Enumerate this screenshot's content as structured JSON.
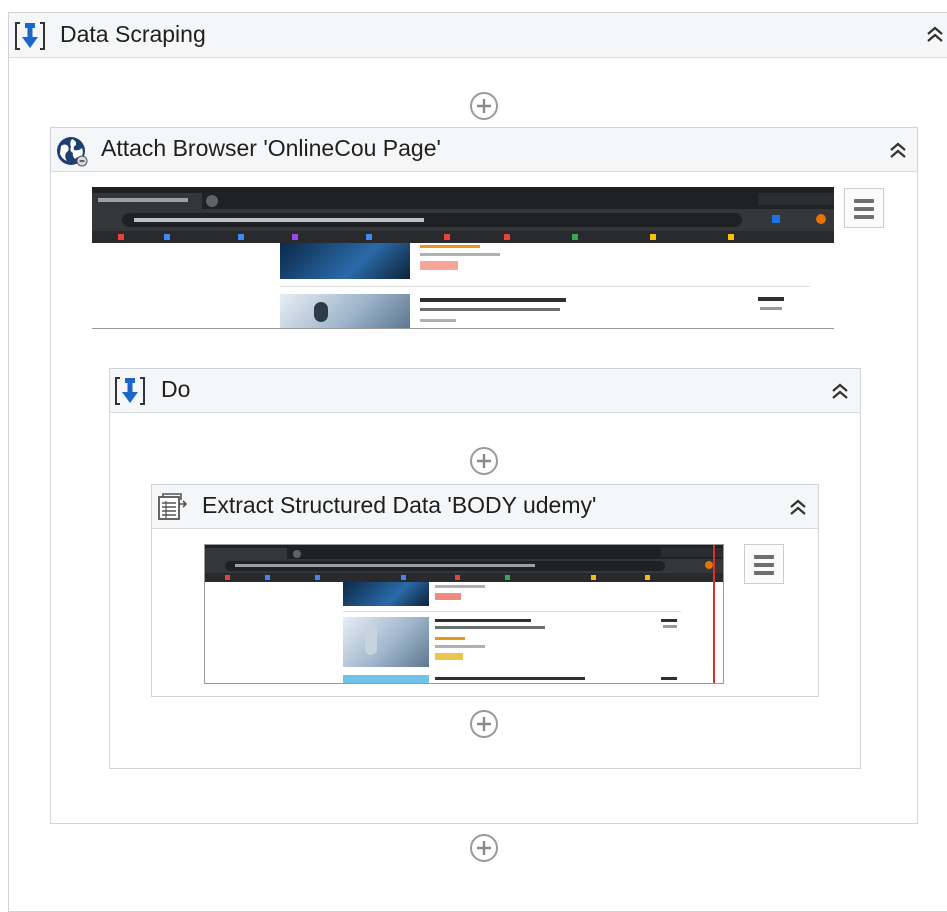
{
  "data_scraping": {
    "title": "Data Scraping",
    "icon": "data-scraping-icon"
  },
  "attach_browser": {
    "title": "Attach Browser 'OnlineCou Page'",
    "icon": "globe-icon"
  },
  "do": {
    "title": "Do",
    "icon": "sequence-icon"
  },
  "extract": {
    "title": "Extract Structured Data 'BODY  udemy'",
    "icon": "extract-table-icon"
  },
  "colors": {
    "header_bg": "#f5f6f7",
    "border": "#cfd4da",
    "icon_blue": "#1b66c9",
    "browser_dark": "#202124"
  }
}
